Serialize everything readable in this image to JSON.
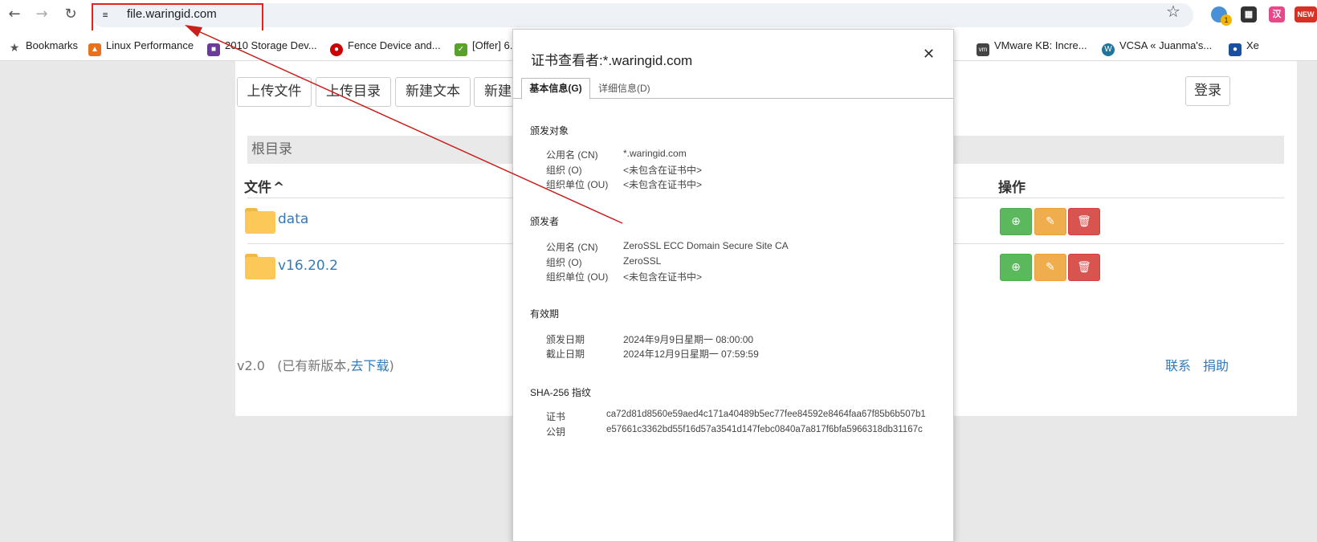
{
  "browser": {
    "url": "file.waringid.com",
    "extensions": [
      {
        "name": "profile-extension",
        "color": "#4a90d9"
      },
      {
        "name": "qr-extension",
        "color": "#333333"
      },
      {
        "name": "translate-extension",
        "color": "#e8488a",
        "label": "汉"
      },
      {
        "name": "new-extension",
        "color": "#d93025",
        "label": "NEW"
      }
    ],
    "profile_badge": "1",
    "bookmarks": [
      {
        "label": "Bookmarks",
        "icon": "star-icon"
      },
      {
        "label": "Linux Performance",
        "icon": "flame-icon",
        "color": "#e8711a"
      },
      {
        "label": "2010 Storage Dev...",
        "icon": "snia-icon",
        "color": "#6a3c98"
      },
      {
        "label": "Fence Device and...",
        "icon": "redhat-icon",
        "color": "#cc0000"
      },
      {
        "label": "[Offer] 6...",
        "icon": "shield-icon",
        "color": "#5aa02c"
      },
      {
        "label": "VMware KB: Incre...",
        "icon": "vmware-icon",
        "color": "#444444"
      },
      {
        "label": "VCSA « Juanma's...",
        "icon": "wordpress-icon",
        "color": "#21759b"
      },
      {
        "label": "Xe",
        "icon": "shield-icon",
        "color": "#1a4fa0"
      }
    ]
  },
  "toolbar": {
    "upload_file": "上传文件",
    "upload_dir": "上传目录",
    "new_text": "新建文本",
    "new_dir": "新建",
    "login": "登录"
  },
  "breadcrumb": "根目录",
  "table": {
    "col_file": "文件",
    "sort_indicator": "^",
    "col_actions": "操作",
    "rows": [
      {
        "name": "data"
      },
      {
        "name": "v16.20.2"
      }
    ]
  },
  "footer": {
    "version": "v2.0",
    "update_prefix": "(已有新版本,",
    "update_link": "去下载",
    "update_suffix": ")",
    "contact": "联系",
    "donate": "捐助"
  },
  "certificate": {
    "title": "证书查看者:*.waringid.com",
    "tab_basic": "基本信息(G)",
    "tab_details": "详细信息(D)",
    "issued_to": {
      "heading": "颁发对象",
      "fields": [
        {
          "key": "公用名 (CN)",
          "value": "*.waringid.com"
        },
        {
          "key": "组织 (O)",
          "value": "<未包含在证书中>"
        },
        {
          "key": "组织单位 (OU)",
          "value": "<未包含在证书中>"
        }
      ]
    },
    "issued_by": {
      "heading": "颁发者",
      "fields": [
        {
          "key": "公用名 (CN)",
          "value": "ZeroSSL ECC Domain Secure Site CA"
        },
        {
          "key": "组织 (O)",
          "value": "ZeroSSL"
        },
        {
          "key": "组织单位 (OU)",
          "value": "<未包含在证书中>"
        }
      ]
    },
    "validity": {
      "heading": "有效期",
      "fields": [
        {
          "key": "颁发日期",
          "value": "2024年9月9日星期一 08:00:00"
        },
        {
          "key": "截止日期",
          "value": "2024年12月9日星期一 07:59:59"
        }
      ]
    },
    "fingerprints": {
      "heading": "SHA-256 指纹",
      "fields": [
        {
          "key": "证书",
          "value": "ca72d81d8560e59aed4c171a40489b5ec77fee84592e8464faa67f85b6b507b1"
        },
        {
          "key": "公钥",
          "value": "e57661c3362bd55f16d57a3541d147febc0840a7a817f6bfa5966318db31167c"
        }
      ]
    }
  },
  "annotation_color": "#c8201b"
}
